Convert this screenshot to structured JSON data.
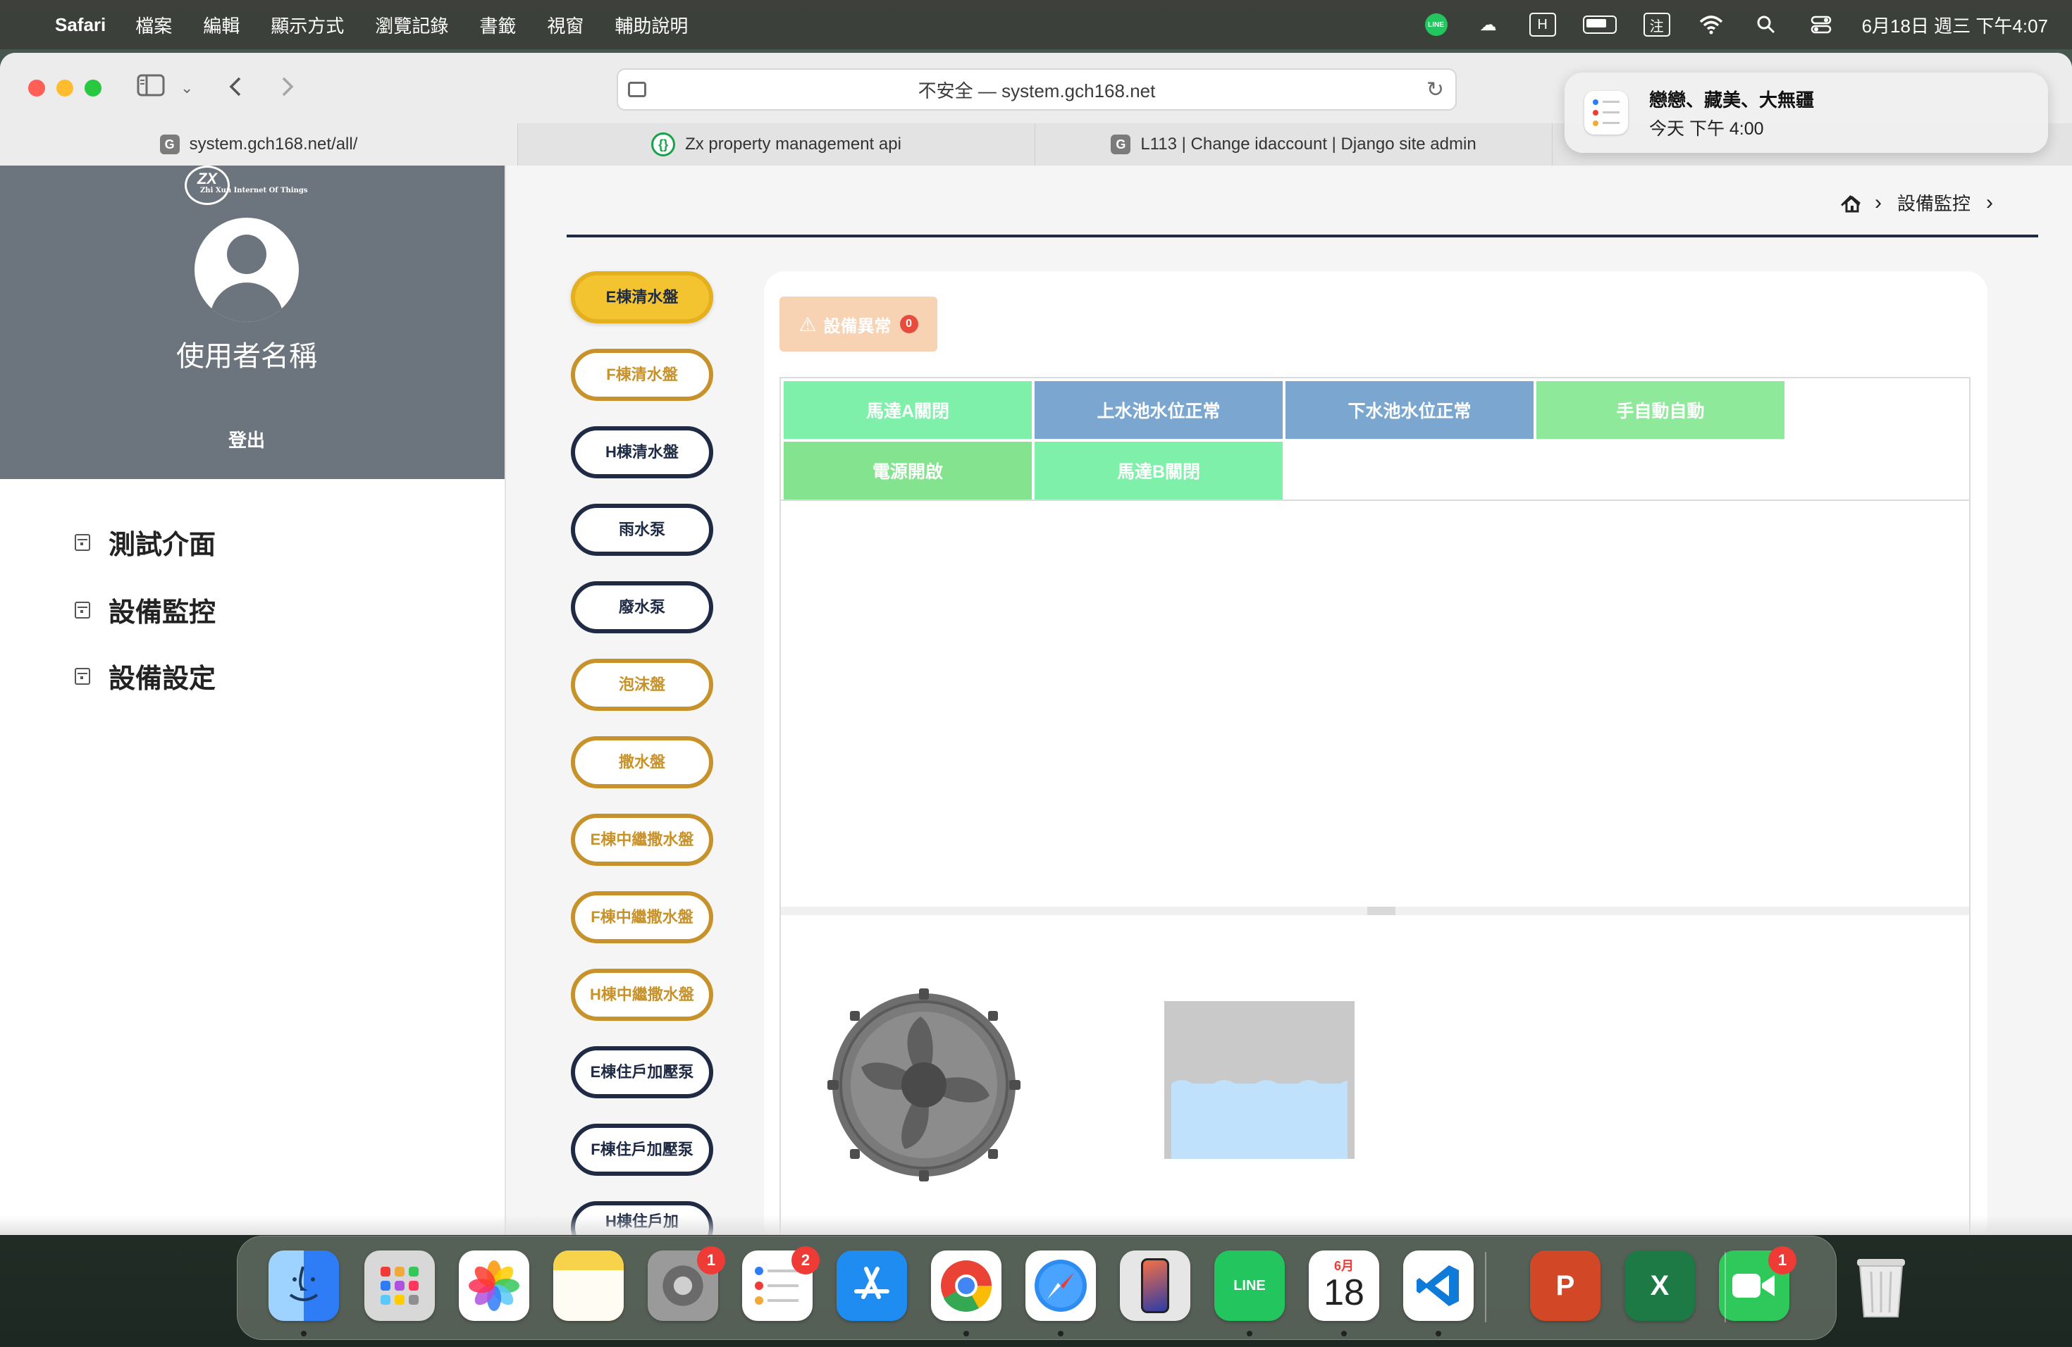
{
  "menubar": {
    "app_name": "Safari",
    "items": [
      "檔案",
      "編輯",
      "顯示方式",
      "瀏覽記錄",
      "書籤",
      "視窗",
      "輔助說明"
    ],
    "line_label": "LINE",
    "input_method": "注",
    "datetime": "6月18日 週三 下午4:07"
  },
  "browser": {
    "address_text": "不安全 — system.gch168.net",
    "tabs": [
      {
        "label": "system.gch168.net/all/",
        "favicon": "G"
      },
      {
        "label": "Zx property management api",
        "favicon": "{·}"
      },
      {
        "label": "L113 | Change idaccount | Django site admin",
        "favicon": "G"
      }
    ]
  },
  "notification": {
    "title": "戀戀、藏美、大無疆",
    "subtitle": "今天 下午 4:00"
  },
  "sidebar": {
    "logo_text": "ZX",
    "logo_tagline": "Zhi Xun Internet Of Things",
    "username": "使用者名稱",
    "logout": "登出",
    "nav": [
      {
        "label": "測試介面",
        "icon": "calendar-icon"
      },
      {
        "label": "設備監控",
        "icon": "calendar-icon"
      },
      {
        "label": "設備設定",
        "icon": "calendar-icon"
      }
    ]
  },
  "breadcrumb": {
    "current": "設備監控"
  },
  "devices": [
    {
      "label": "E棟清水盤",
      "style": "active"
    },
    {
      "label": "F棟清水盤",
      "style": "gold"
    },
    {
      "label": "H棟清水盤",
      "style": "navy"
    },
    {
      "label": "雨水泵",
      "style": "navy"
    },
    {
      "label": "廢水泵",
      "style": "navy"
    },
    {
      "label": "泡沫盤",
      "style": "gold"
    },
    {
      "label": "撒水盤",
      "style": "gold"
    },
    {
      "label": "E棟中繼撒水盤",
      "style": "gold"
    },
    {
      "label": "F棟中繼撒水盤",
      "style": "gold"
    },
    {
      "label": "H棟中繼撒水盤",
      "style": "gold"
    },
    {
      "label": "E棟住戶加壓泵",
      "style": "navy"
    },
    {
      "label": "F棟住戶加壓泵",
      "style": "navy"
    },
    {
      "label": "H棟住戶加",
      "style": "navy"
    }
  ],
  "alarm": {
    "label": "設備異常",
    "count": "0"
  },
  "status_tiles": [
    {
      "label": "馬達A關閉",
      "color": "#7ef0a9"
    },
    {
      "label": "上水池水位正常",
      "color": "#7aa6cf"
    },
    {
      "label": "下水池水位正常",
      "color": "#7aa6cf"
    },
    {
      "label": "手自動自動",
      "color": "#8ee99a"
    },
    {
      "label": "電源開啟",
      "color": "#84e38e"
    },
    {
      "label": "馬達B關閉",
      "color": "#7ef0a9"
    }
  ],
  "graphics": {
    "fan": "fan-icon",
    "tank": "water-tank",
    "tank_fill_fraction": 0.5
  },
  "dock": [
    {
      "name": "finder-icon",
      "color": "#3b8fe8"
    },
    {
      "name": "launchpad-icon",
      "color": "#d8d8d8"
    },
    {
      "name": "photos-icon",
      "color": "#ffffff"
    },
    {
      "name": "notes-icon",
      "color": "#f6d34a"
    },
    {
      "name": "system-settings-icon",
      "color": "#8a8a8a",
      "badge": "1"
    },
    {
      "name": "reminders-icon",
      "color": "#ffffff",
      "badge": "2"
    },
    {
      "name": "app-store-icon",
      "color": "#1f8cf2"
    },
    {
      "name": "chrome-icon",
      "color": "#ffffff"
    },
    {
      "name": "safari-icon",
      "color": "#2d8cf0"
    },
    {
      "name": "iphone-mirroring-icon",
      "color": "#9aa0a6"
    },
    {
      "name": "line-icon",
      "color": "#22c55e",
      "text": "LINE"
    },
    {
      "name": "calendar-icon",
      "color": "#ffffff",
      "month": "6月",
      "day": "18"
    },
    {
      "name": "vscode-icon",
      "color": "#ffffff"
    },
    {
      "name": "powerpoint-icon",
      "color": "#d24726",
      "text": "P"
    },
    {
      "name": "excel-icon",
      "color": "#1d7a45",
      "text": "X"
    },
    {
      "name": "facetime-icon",
      "color": "#2fc85a",
      "badge": "1"
    },
    {
      "name": "trash-icon",
      "color": "#e8e8e8"
    }
  ]
}
